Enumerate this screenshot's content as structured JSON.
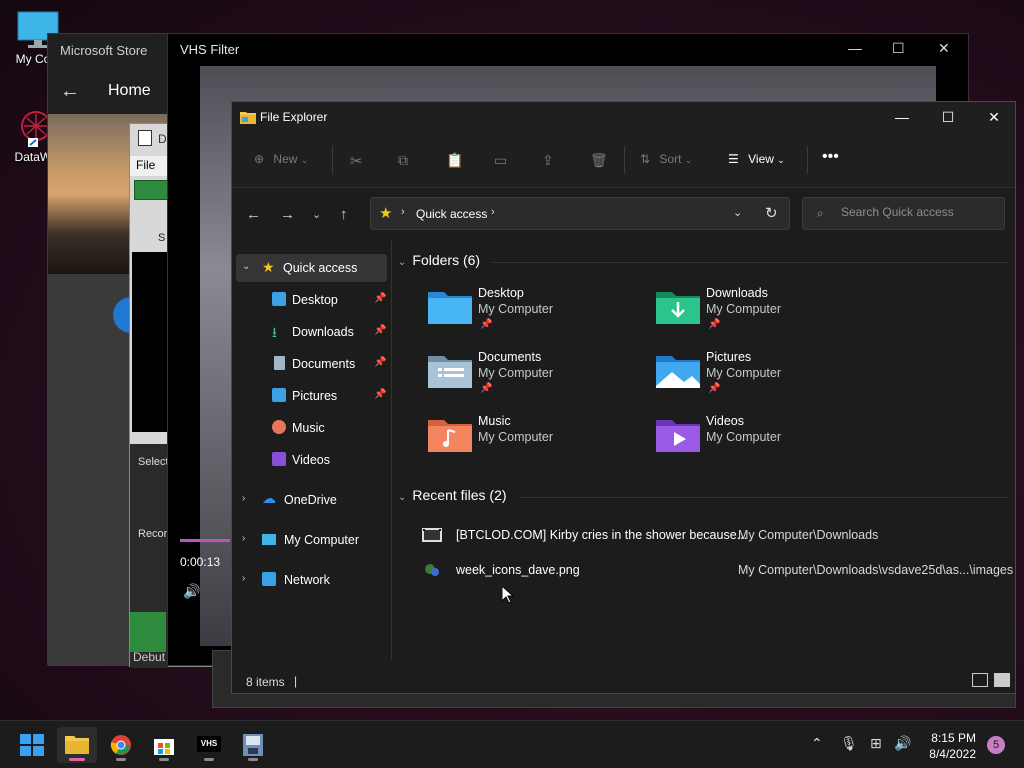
{
  "desktop": {
    "icons": [
      {
        "label": "My Com"
      },
      {
        "label": "DataWa"
      }
    ]
  },
  "ms_store": {
    "title": "Microsoft Store",
    "nav_home": "Home"
  },
  "debut": {
    "title_frag": "D",
    "menu_file": "File",
    "label_select": "Select",
    "label_record": "Recor",
    "label_debut": "Debut",
    "label_s": "S"
  },
  "vhs": {
    "title": "VHS Filter",
    "time": "0:00:13"
  },
  "explorer": {
    "title": "File Explorer",
    "commands": {
      "new": "New",
      "sort": "Sort",
      "view": "View"
    },
    "address": {
      "location": "Quick access"
    },
    "search": {
      "placeholder": "Search Quick access"
    },
    "sidebar": {
      "quick_access": "Quick access",
      "items": [
        {
          "label": "Desktop",
          "pinned": true
        },
        {
          "label": "Downloads",
          "pinned": true
        },
        {
          "label": "Documents",
          "pinned": true
        },
        {
          "label": "Pictures",
          "pinned": true
        },
        {
          "label": "Music",
          "pinned": false
        },
        {
          "label": "Videos",
          "pinned": false
        }
      ],
      "onedrive": "OneDrive",
      "my_computer": "My Computer",
      "network": "Network"
    },
    "folders_header": "Folders (6)",
    "folders": [
      {
        "name": "Desktop",
        "location": "My Computer",
        "pinned": true
      },
      {
        "name": "Downloads",
        "location": "My Computer",
        "pinned": true
      },
      {
        "name": "Documents",
        "location": "My Computer",
        "pinned": true
      },
      {
        "name": "Pictures",
        "location": "My Computer",
        "pinned": true
      },
      {
        "name": "Music",
        "location": "My Computer",
        "pinned": false
      },
      {
        "name": "Videos",
        "location": "My Computer",
        "pinned": false
      }
    ],
    "recent_header": "Recent files (2)",
    "recent_files": [
      {
        "name": "[BTCLOD.COM] Kirby cries in the shower because...",
        "location": "My Computer\\Downloads"
      },
      {
        "name": "week_icons_dave.png",
        "location": "My Computer\\Downloads\\vsdave25d\\as...\\images"
      }
    ],
    "status": {
      "count": "8 items"
    }
  },
  "taskbar": {
    "time": "8:15 PM",
    "date": "8/4/2022",
    "notifications": "5"
  },
  "colors": {
    "accent_pink": "#d96aa4",
    "star_yellow": "#f5c518",
    "folder_blue": "#3aa0e8"
  }
}
